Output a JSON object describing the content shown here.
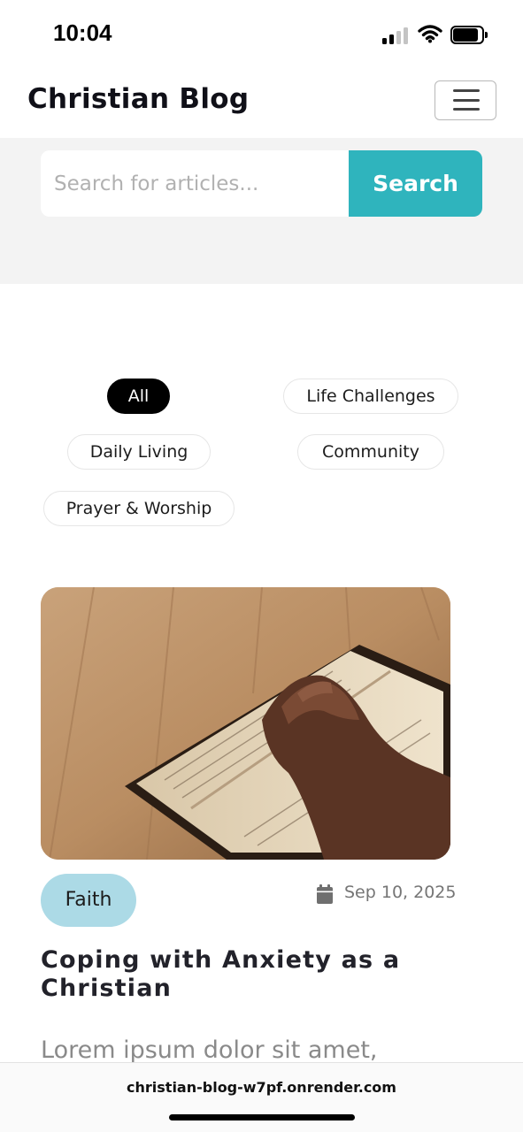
{
  "status_bar": {
    "time": "10:04"
  },
  "header": {
    "brand": "Christian Blog"
  },
  "search": {
    "placeholder": "Search for articles...",
    "button_label": "Search"
  },
  "filters": [
    {
      "label": "All",
      "active": true
    },
    {
      "label": "Life Challenges",
      "active": false
    },
    {
      "label": "Daily Living",
      "active": false
    },
    {
      "label": "Community",
      "active": false
    },
    {
      "label": "Prayer & Worship",
      "active": false
    }
  ],
  "article": {
    "category": "Faith",
    "date": "Sep 10, 2025",
    "title": "Coping with Anxiety as a Christian",
    "excerpt": "Lorem ipsum dolor sit amet,"
  },
  "browser": {
    "url": "christian-blog-w7pf.onrender.com"
  },
  "colors": {
    "accent": "#2fb4bd",
    "tag_background": "#acdae6",
    "active_chip": "#000000",
    "search_band": "#f3f3f3"
  }
}
